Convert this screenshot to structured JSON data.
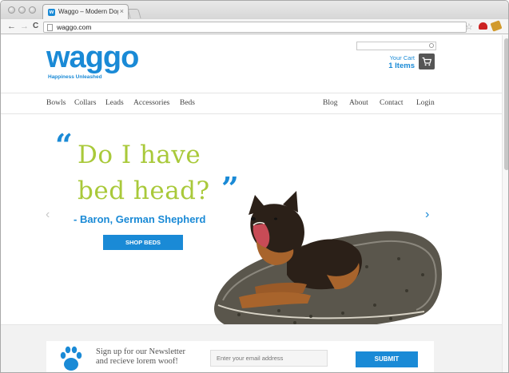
{
  "browser": {
    "tab_title": "Waggo – Modern Dog Bowls",
    "tab_favicon_letter": "w",
    "tab_close": "×",
    "back_icon": "←",
    "forward_icon": "→",
    "reload_icon": "C",
    "url": "waggo.com",
    "star_icon": "☆"
  },
  "header": {
    "logo_text": "waggo",
    "logo_tagline": "Happiness Unleashed",
    "search_placeholder": "",
    "cart_label": "Your Cart",
    "cart_count": "1 Items"
  },
  "nav": {
    "left": [
      "Bowls",
      "Collars",
      "Leads",
      "Accessories",
      "Beds"
    ],
    "right": [
      "Blog",
      "About",
      "Contact",
      "Login"
    ]
  },
  "hero": {
    "open_quote": "“",
    "line1": "Do I have",
    "line2": "bed head?",
    "close_quote": "”",
    "attribution": "- Baron, German Shepherd",
    "button_label": "SHOP BEDS",
    "prev_arrow": "‹",
    "next_arrow": "›"
  },
  "newsletter": {
    "line1": "Sign up for our Newsletter",
    "line2": "and recieve lorem woof!",
    "input_placeholder": "Enter your email address",
    "button_label": "SUBMIT"
  },
  "colors": {
    "brand_blue": "#1a8ad6",
    "hero_green": "#a9c93a",
    "cart_dark": "#555555"
  }
}
